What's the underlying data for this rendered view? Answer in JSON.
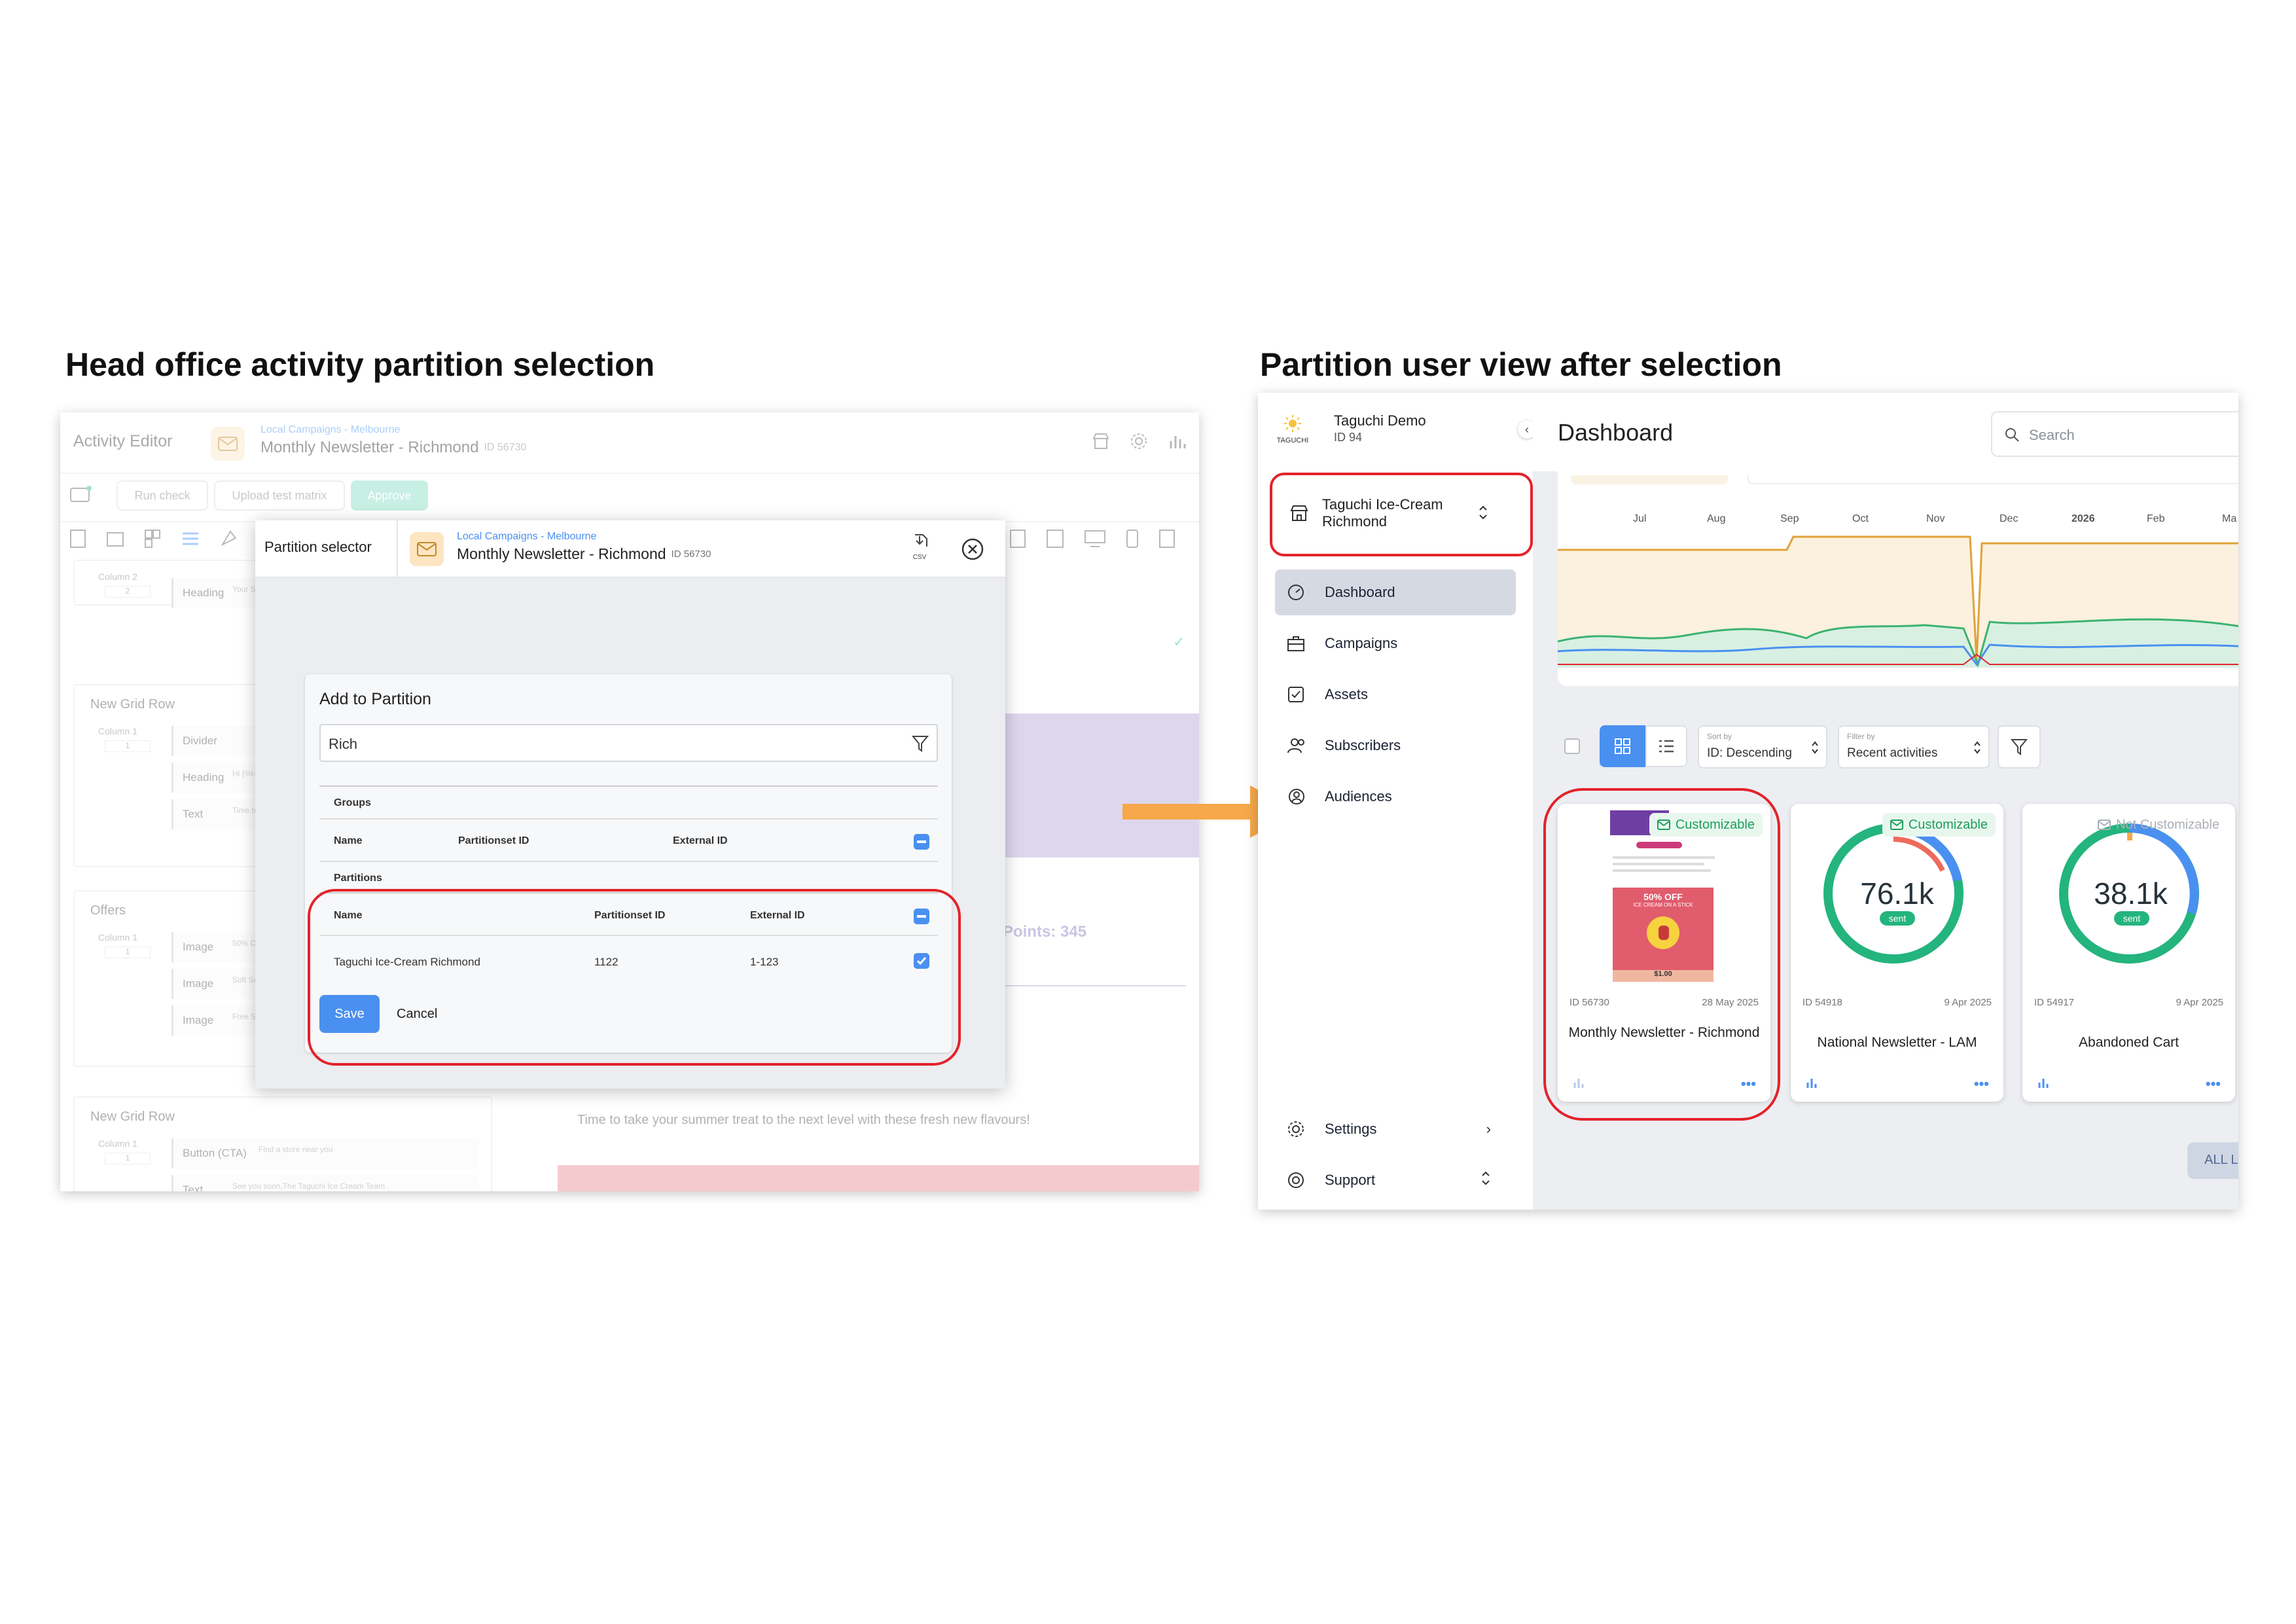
{
  "headings": {
    "left": "Head office activity partition selection",
    "right": "Partition user view after selection"
  },
  "editor": {
    "title": "Activity Editor",
    "breadcrumb": "Local Campaigns - Melbourne",
    "campaign_name": "Monthly Newsletter - Richmond",
    "campaign_id": "ID 56730",
    "toolbar": {
      "run_check": "Run check",
      "upload_test_matrix": "Upload test matrix",
      "approve": "Approve"
    },
    "blocks": [
      {
        "title": "",
        "column": "Column 2",
        "col_num": "2",
        "rows": [
          {
            "label": "Heading",
            "snippet": "Your Sc... recipien..."
          }
        ]
      },
      {
        "title": "New Grid Row",
        "column": "Column 1",
        "col_num": "1",
        "rows": [
          {
            "label": "Divider",
            "snippet": ""
          },
          {
            "label": "Heading",
            "snippet": "Hi {%l-... \"Scoops..."
          },
          {
            "label": "Text",
            "snippet": "Time to take... next level w..."
          }
        ]
      },
      {
        "title": "Offers",
        "column": "Column 1",
        "col_num": "1",
        "rows": [
          {
            "label": "Image",
            "snippet": "50% Off Ic..."
          },
          {
            "label": "Image",
            "snippet": "Soft Serve..."
          },
          {
            "label": "Image",
            "snippet": "Free Sprink..."
          }
        ]
      },
      {
        "title": "New Grid Row",
        "column": "Column 1",
        "col_num": "1",
        "rows": [
          {
            "label": "Button (CTA)",
            "snippet": "Find a store near you"
          },
          {
            "label": "Text",
            "snippet": "See you soon,The Taguchi Ice Cream Team"
          }
        ]
      }
    ],
    "preview": {
      "points": "Points: 345",
      "body_text": "Time to take your summer treat to the next level with these fresh new flavours!"
    }
  },
  "modal": {
    "title": "Partition selector",
    "breadcrumb": "Local Campaigns - Melbourne",
    "campaign_name": "Monthly Newsletter - Richmond",
    "campaign_id": "ID 56730",
    "csv_label": "CSV",
    "dialog_title": "Add to Partition",
    "search_value": "Rich",
    "groups_label": "Groups",
    "partitions_label": "Partitions",
    "columns": {
      "name": "Name",
      "partitionset_id": "Partitionset ID",
      "external_id": "External ID"
    },
    "rows": [
      {
        "name": "Taguchi Ice-Cream Richmond",
        "partitionset_id": "1122",
        "external_id": "1-123"
      }
    ],
    "save": "Save",
    "cancel": "Cancel"
  },
  "app": {
    "org_name": "Taguchi Demo",
    "org_id": "ID 94",
    "logo_text": "TAGUCHI",
    "partition_line1": "Taguchi Ice-Cream",
    "partition_line2": "Richmond",
    "nav": [
      "Dashboard",
      "Campaigns",
      "Assets",
      "Subscribers",
      "Audiences"
    ],
    "nav_bottom": [
      "Settings",
      "Support"
    ],
    "page_title": "Dashboard",
    "search_placeholder": "Search",
    "chart_months": [
      "Jul",
      "Aug",
      "Sep",
      "Oct",
      "Nov",
      "Dec",
      "2026",
      "Feb",
      "Ma"
    ],
    "sort_label": "Sort by",
    "sort_value": "ID: Descending",
    "filter_label": "Filter by",
    "filter_value": "Recent activities",
    "cards": [
      {
        "badge": "Customizable",
        "id": "ID 56730",
        "date": "28 May 2025",
        "name": "Monthly Newsletter - Richmond",
        "thumb_text1": "50% OFF",
        "thumb_text2": "ICE CREAM ON A STICK",
        "price": "$1.00"
      },
      {
        "badge": "Customizable",
        "id": "ID 54918",
        "date": "9 Apr 2025",
        "name": "National Newsletter - LAM",
        "stat": "76.1k",
        "stat_label": "sent"
      },
      {
        "badge": "Not Customizable",
        "id": "ID 54917",
        "date": "9 Apr 2025",
        "name": "Abandoned Cart",
        "stat": "38.1k",
        "stat_label": "sent"
      }
    ],
    "all_button": "ALL LO"
  },
  "colors": {
    "accent_blue": "#4a90f0",
    "approve_green": "#86dcc4",
    "red_outline": "#e3232a",
    "arrow": "#f6a84a",
    "nav_active": "#d5d9e2"
  }
}
